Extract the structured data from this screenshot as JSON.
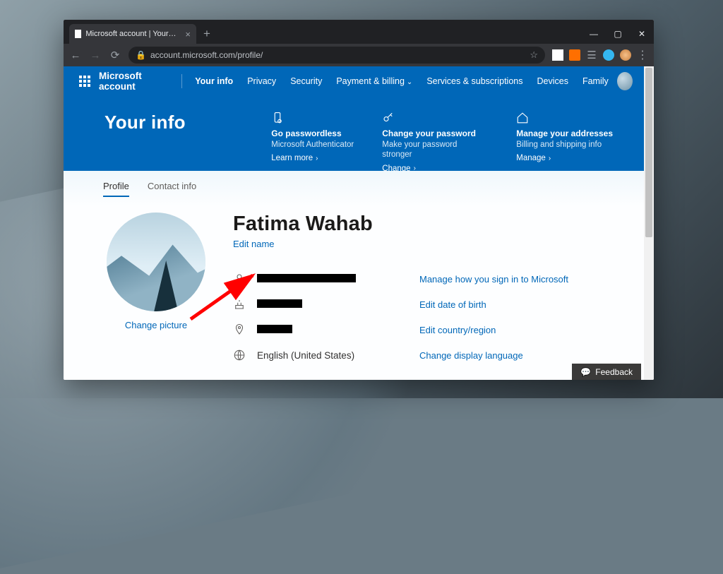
{
  "browser": {
    "tab_title": "Microsoft account | Your profile | ...",
    "url": "account.microsoft.com/profile/"
  },
  "nav": {
    "brand": "Microsoft account",
    "links": [
      "Your info",
      "Privacy",
      "Security",
      "Payment & billing",
      "Services & subscriptions",
      "Devices",
      "Family"
    ],
    "active_index": 0,
    "dropdown_index": 3
  },
  "hero": {
    "title": "Your info",
    "cards": [
      {
        "icon": "phone-lock-icon",
        "title": "Go passwordless",
        "desc": "Microsoft Authenticator",
        "action": "Learn more"
      },
      {
        "icon": "key-icon",
        "title": "Change your password",
        "desc": "Make your password stronger",
        "action": "Change"
      },
      {
        "icon": "home-icon",
        "title": "Manage your addresses",
        "desc": "Billing and shipping info",
        "action": "Manage"
      }
    ]
  },
  "tabs": {
    "items": [
      "Profile",
      "Contact info"
    ],
    "selected": 0
  },
  "profile": {
    "change_picture": "Change picture",
    "name": "Fatima Wahab",
    "edit_name": "Edit name",
    "rows": [
      {
        "icon": "person-icon",
        "value_redacted": true,
        "redact_w": 140,
        "action": "Manage how you sign in to Microsoft"
      },
      {
        "icon": "cake-icon",
        "value_redacted": true,
        "redact_w": 64,
        "action": "Edit date of birth"
      },
      {
        "icon": "pin-icon",
        "value_redacted": true,
        "redact_w": 50,
        "action": "Edit country/region"
      },
      {
        "icon": "globe-icon",
        "value": "English (United States)",
        "action": "Change display language"
      }
    ]
  },
  "feedback": "Feedback"
}
